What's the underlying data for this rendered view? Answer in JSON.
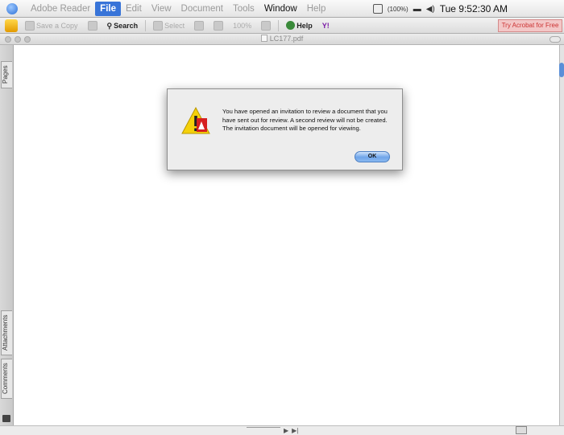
{
  "menubar": {
    "items": [
      "Adobe Reader",
      "File",
      "Edit",
      "View",
      "Document",
      "Tools",
      "Window",
      "Help"
    ],
    "active": "File",
    "battery": "(100%)",
    "clock": "Tue 9:52:30 AM"
  },
  "toolbar": {
    "save_copy": "Save a Copy",
    "search": "Search",
    "select": "Select",
    "zoom_value": "100%",
    "help": "Help",
    "yahoo": "Y!",
    "try_acrobat": "Try Acrobat for Free"
  },
  "document": {
    "title": "LC177.pdf",
    "tabs": {
      "pages": "Pages",
      "attachments": "Attachments",
      "comments": "Comments"
    }
  },
  "pager": {
    "next": "▶",
    "last": "▶|"
  },
  "dialog": {
    "message": "You have opened an invitation to review a document that you have sent out for review.  A second review will not be created.  The invitation document will be opened for viewing.",
    "ok_label": "OK"
  },
  "colors": {
    "accent": "#3874d8",
    "dialog_bg": "#ededed",
    "ok_button": "#6fa5e9"
  }
}
